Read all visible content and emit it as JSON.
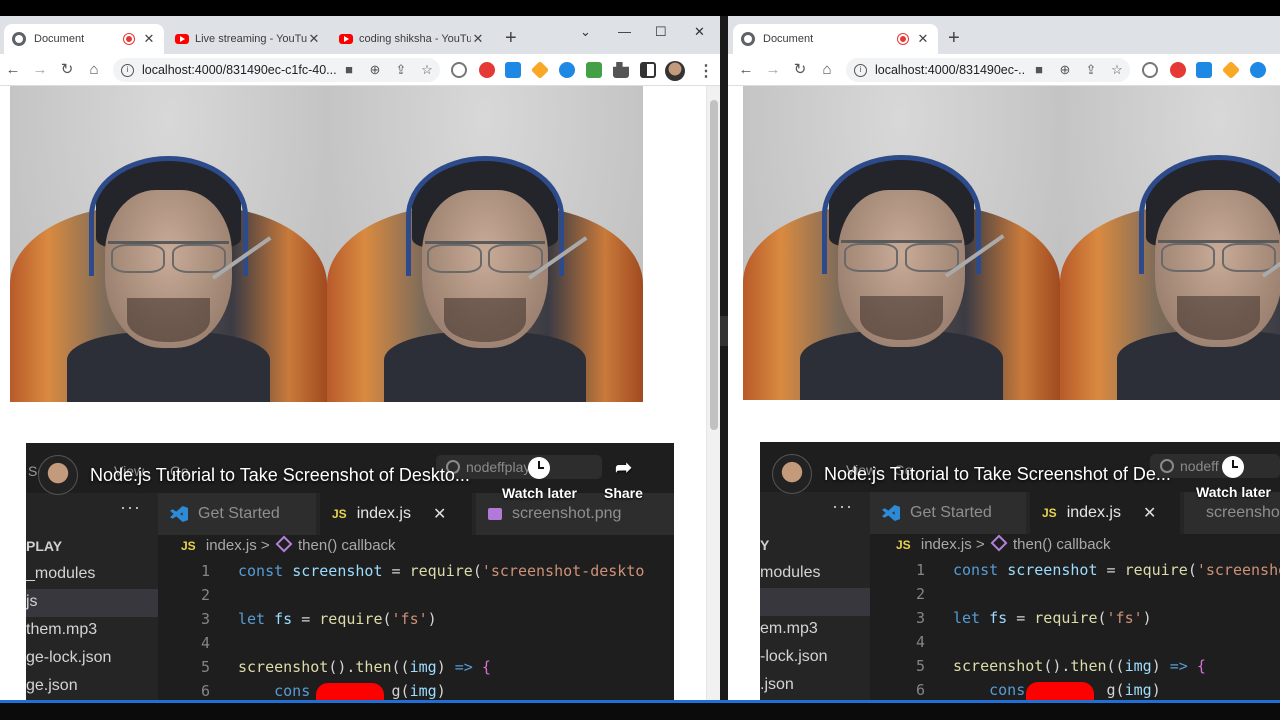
{
  "left_browser": {
    "tabs": [
      {
        "title": "Document",
        "recording": true
      },
      {
        "title": "Live streaming - YouTube"
      },
      {
        "title": "coding shiksha - YouTube"
      }
    ],
    "url": "localhost:4000/831490ec-c1fc-40..."
  },
  "right_browser": {
    "tabs": [
      {
        "title": "Document",
        "recording": true
      }
    ],
    "url": "localhost:4000/831490ec-..."
  },
  "icons": {
    "back": "←",
    "forward": "→",
    "reload": "↻",
    "home": "⌂",
    "new_tab": "+",
    "close": "✕",
    "minimize": "—",
    "maximize": "☐",
    "tab_search": "⌄",
    "camera": "■",
    "zoom": "⊕",
    "share_page": "⇪",
    "star": "☆",
    "menu": "⋮",
    "info": "i",
    "share": "➦"
  },
  "extension_colors": [
    "#888888",
    "#e53935",
    "#1e88e5",
    "#f9a825",
    "#1e88e5",
    "#43a047",
    "#555555",
    "#333333"
  ],
  "video": {
    "title_left": "Node.js Tutorial to Take Screenshot of Deskto...",
    "title_right": "Node.js Tutorial to Take Screenshot of De...",
    "watch_later": "Watch later",
    "share": "Share",
    "editor": {
      "menu": [
        "Se",
        "View",
        "Go"
      ],
      "search": "nodeffplay",
      "search_right": "nodeff",
      "sidebar_dots": "···",
      "sidebar_head_left": "PLAY",
      "sidebar_head_right": "Y",
      "sidebar_items_left": [
        "_modules",
        "js",
        "them.mp3",
        "ge-lock.json",
        "ge.json"
      ],
      "sidebar_items_right": [
        "modules",
        "",
        "em.mp3",
        "-lock.json",
        ".json"
      ],
      "tabs": [
        "Get Started",
        "index.js",
        "screenshot.png"
      ],
      "tab_badge": "JS",
      "tab_close": "✕",
      "crumb_file": "index.js",
      "crumb_sep": ">",
      "crumb_symbol": "then() callback",
      "lines": [
        {
          "n": "1",
          "tokens": [
            [
              "kw",
              "const "
            ],
            [
              "var",
              "screenshot"
            ],
            [
              "pun",
              " = "
            ],
            [
              "fn",
              "require"
            ],
            [
              "pun",
              "("
            ],
            [
              "str",
              "'screenshot-deskto"
            ]
          ]
        },
        {
          "n": "2",
          "tokens": []
        },
        {
          "n": "3",
          "tokens": [
            [
              "kw",
              "let "
            ],
            [
              "var",
              "fs"
            ],
            [
              "pun",
              " = "
            ],
            [
              "fn",
              "require"
            ],
            [
              "pun",
              "("
            ],
            [
              "str",
              "'fs'"
            ],
            [
              "pun",
              ")"
            ]
          ]
        },
        {
          "n": "4",
          "tokens": []
        },
        {
          "n": "5",
          "tokens": [
            [
              "fn",
              "screenshot"
            ],
            [
              "pun",
              "()."
            ],
            [
              "fn",
              "then"
            ],
            [
              "pun",
              "(("
            ],
            [
              "var",
              "img"
            ],
            [
              "pun",
              ") "
            ],
            [
              "kw",
              "=>"
            ],
            [
              "pun",
              " "
            ],
            [
              "br",
              "{"
            ]
          ]
        },
        {
          "n": "6",
          "tokens": [
            [
              "pun",
              "    "
            ],
            [
              "kw",
              "cons"
            ],
            [
              "pun",
              "         "
            ],
            [
              "pun",
              "g("
            ],
            [
              "var",
              "img"
            ],
            [
              "pun",
              ")"
            ]
          ]
        }
      ]
    }
  }
}
